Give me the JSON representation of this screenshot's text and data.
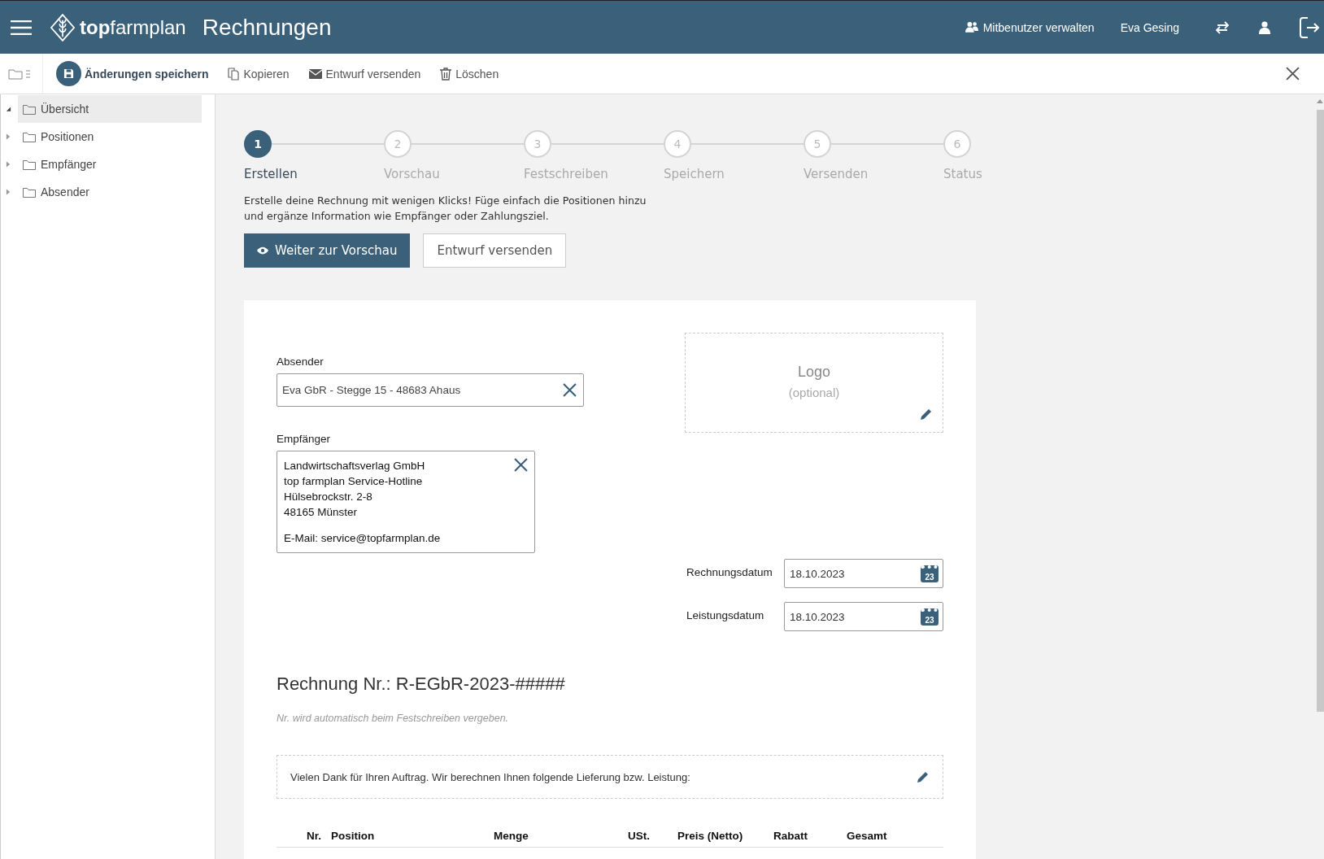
{
  "header": {
    "brand_bold": "top",
    "brand_light": "farmplan",
    "title": "Rechnungen",
    "links": [
      {
        "label": "Mitbenutzer verwalten",
        "kind": "users"
      },
      {
        "label": "Eva Gesing",
        "kind": "plain"
      }
    ],
    "icons": [
      {
        "kind": "swap"
      },
      {
        "kind": "user"
      },
      {
        "kind": "logout"
      }
    ]
  },
  "toolbar": {
    "actions": [
      {
        "label": "Änderungen speichern",
        "kind": "save"
      },
      {
        "label": "Kopieren",
        "kind": "copy"
      },
      {
        "label": "Entwurf versenden",
        "kind": "mail"
      },
      {
        "label": "Löschen",
        "kind": "trash"
      }
    ]
  },
  "sidebar": {
    "items": [
      {
        "label": "Übersicht",
        "selected": true,
        "expanded": true
      },
      {
        "label": "Positionen",
        "selected": false,
        "expanded": false
      },
      {
        "label": "Empfänger",
        "selected": false,
        "expanded": false
      },
      {
        "label": "Absender",
        "selected": false,
        "expanded": false
      }
    ]
  },
  "stepper": {
    "steps": [
      {
        "number": "1",
        "label": "Erstellen",
        "selected": true
      },
      {
        "number": "2",
        "label": "Vorschau",
        "selected": false
      },
      {
        "number": "3",
        "label": "Festschreiben",
        "selected": false
      },
      {
        "number": "4",
        "label": "Speichern",
        "selected": false
      },
      {
        "number": "5",
        "label": "Versenden",
        "selected": false
      },
      {
        "number": "6",
        "label": "Status",
        "selected": false
      }
    ]
  },
  "description": "Erstelle deine Rechnung mit wenigen Klicks! Füge einfach die Positionen hinzu und ergänze Information wie Empfänger oder Zahlungsziel.",
  "buttons": [
    {
      "label": "Weiter zur Vorschau",
      "kind": "primary"
    },
    {
      "label": "Entwurf versenden",
      "kind": "secondary"
    }
  ],
  "invoice": {
    "sender": {
      "label": "Absender",
      "value": "Eva GbR - Stegge 15 - 48683 Ahaus"
    },
    "recipient": {
      "label": "Empfänger",
      "lines": [
        "Landwirtschaftsverlag GmbH",
        "top farmplan Service-Hotline",
        "Hülsebrockstr. 2-8",
        "48165 Münster"
      ],
      "email": "E-Mail: service@topfarmplan.de"
    },
    "logo": {
      "title": "Logo",
      "hint": "(optional)"
    },
    "dates": [
      {
        "label": "Rechnungsdatum",
        "value": "18.10.2023",
        "day": "23"
      },
      {
        "label": "Leistungsdatum",
        "value": "18.10.2023",
        "day": "23"
      }
    ],
    "number_title": "Rechnung Nr.: R-EGbR-2023-#####",
    "number_note": "Nr. wird automatisch beim Festschreiben vergeben.",
    "intro": "Vielen Dank für Ihren Auftrag. Wir berechnen Ihnen folgende Lieferung bzw. Leistung:",
    "columns": [
      "Nr.",
      "Position",
      "Menge",
      "USt.",
      "Preis (Netto)",
      "Rabatt",
      "Gesamt"
    ]
  }
}
